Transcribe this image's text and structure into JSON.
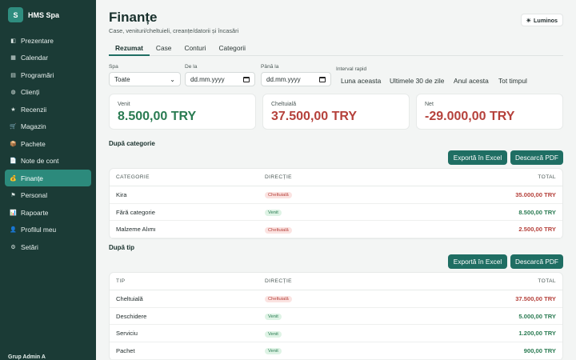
{
  "brand": {
    "logo_letter": "S",
    "name": "HMS Spa"
  },
  "sidebar": {
    "items": [
      {
        "icon": "presentation-icon",
        "glyph": "◧",
        "label": "Prezentare"
      },
      {
        "icon": "calendar-icon",
        "glyph": "▦",
        "label": "Calendar"
      },
      {
        "icon": "appointments-icon",
        "glyph": "▤",
        "label": "Programări"
      },
      {
        "icon": "clients-icon",
        "glyph": "◍",
        "label": "Clienți"
      },
      {
        "icon": "star-icon",
        "glyph": "★",
        "label": "Recenzii"
      },
      {
        "icon": "cart-icon",
        "glyph": "🛒",
        "label": "Magazin"
      },
      {
        "icon": "package-icon",
        "glyph": "📦",
        "label": "Pachete"
      },
      {
        "icon": "note-icon",
        "glyph": "📄",
        "label": "Note de cont"
      },
      {
        "icon": "money-bag-icon",
        "glyph": "💰",
        "label": "Finanțe"
      },
      {
        "icon": "flag-icon",
        "glyph": "⚑",
        "label": "Personal"
      },
      {
        "icon": "chart-icon",
        "glyph": "📊",
        "label": "Rapoarte"
      },
      {
        "icon": "profile-icon",
        "glyph": "👤",
        "label": "Profilul meu"
      },
      {
        "icon": "gear-icon",
        "glyph": "⚙",
        "label": "Setări"
      }
    ],
    "active_index": 8,
    "footer": "Grup Admin A"
  },
  "header": {
    "title": "Finanțe",
    "subtitle": "Case, venituri/cheltuieli, creanțe/datorii și încasări",
    "theme_glyph": "☀",
    "theme_label": "Luminos"
  },
  "tabs": [
    "Rezumat",
    "Case",
    "Conturi",
    "Categorii"
  ],
  "active_tab": 0,
  "filters": {
    "spa_label": "Spa",
    "spa_value": "Toate",
    "from_label": "De la",
    "from_placeholder": "dd.mm.yyyy",
    "to_label": "Până la",
    "to_placeholder": "dd.mm.yyyy",
    "quick_label": "Interval rapid",
    "quick_options": [
      "Luna aceasta",
      "Ultimele 30 de zile",
      "Anul acesta",
      "Tot timpul"
    ]
  },
  "summary": {
    "income_label": "Venit",
    "income_value": "8.500,00 TRY",
    "expense_label": "Cheltuială",
    "expense_value": "37.500,00 TRY",
    "net_label": "Net",
    "net_value": "-29.000,00 TRY"
  },
  "actions": {
    "export_excel": "Exportă în Excel",
    "download_pdf": "Descarcă PDF"
  },
  "by_category": {
    "title": "După categorie",
    "headers": [
      "CATEGORIE",
      "DIRECȚIE",
      "TOTAL"
    ],
    "rows": [
      {
        "name": "Kira",
        "direction": "Cheltuială",
        "type": "exp",
        "total": "35.000,00 TRY"
      },
      {
        "name": "Fără categorie",
        "direction": "Venit",
        "type": "inc",
        "total": "8.500,00 TRY"
      },
      {
        "name": "Malzeme Alımı",
        "direction": "Cheltuială",
        "type": "exp",
        "total": "2.500,00 TRY"
      }
    ]
  },
  "by_type": {
    "title": "După tip",
    "headers": [
      "TIP",
      "DIRECȚIE",
      "TOTAL"
    ],
    "rows": [
      {
        "name": "Cheltuială",
        "direction": "Cheltuială",
        "type": "exp",
        "total": "37.500,00 TRY"
      },
      {
        "name": "Deschidere",
        "direction": "Venit",
        "type": "inc",
        "total": "5.000,00 TRY"
      },
      {
        "name": "Serviciu",
        "direction": "Venit",
        "type": "inc",
        "total": "1.200,00 TRY"
      },
      {
        "name": "Pachet",
        "direction": "Venit",
        "type": "inc",
        "total": "900,00 TRY"
      }
    ]
  },
  "colors": {
    "sidebar_bg": "#1b3b36",
    "accent": "#1f6e63",
    "income": "#2a7b52",
    "expense": "#b5413b"
  }
}
